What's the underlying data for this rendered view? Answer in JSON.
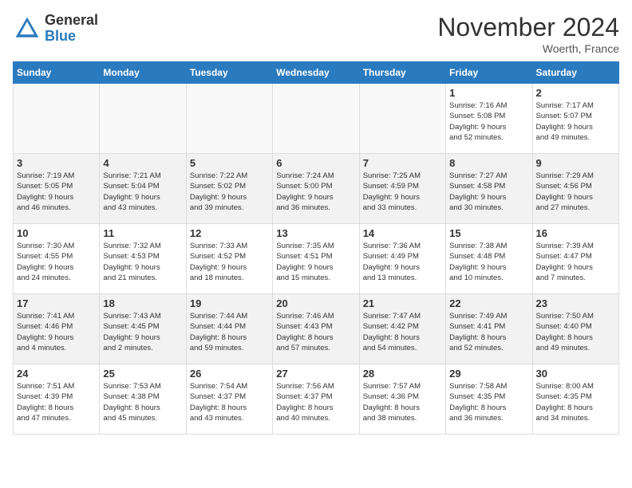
{
  "logo": {
    "general": "General",
    "blue": "Blue"
  },
  "title": "November 2024",
  "location": "Woerth, France",
  "days_of_week": [
    "Sunday",
    "Monday",
    "Tuesday",
    "Wednesday",
    "Thursday",
    "Friday",
    "Saturday"
  ],
  "weeks": [
    [
      {
        "day": "",
        "info": ""
      },
      {
        "day": "",
        "info": ""
      },
      {
        "day": "",
        "info": ""
      },
      {
        "day": "",
        "info": ""
      },
      {
        "day": "",
        "info": ""
      },
      {
        "day": "1",
        "info": "Sunrise: 7:16 AM\nSunset: 5:08 PM\nDaylight: 9 hours\nand 52 minutes."
      },
      {
        "day": "2",
        "info": "Sunrise: 7:17 AM\nSunset: 5:07 PM\nDaylight: 9 hours\nand 49 minutes."
      }
    ],
    [
      {
        "day": "3",
        "info": "Sunrise: 7:19 AM\nSunset: 5:05 PM\nDaylight: 9 hours\nand 46 minutes."
      },
      {
        "day": "4",
        "info": "Sunrise: 7:21 AM\nSunset: 5:04 PM\nDaylight: 9 hours\nand 43 minutes."
      },
      {
        "day": "5",
        "info": "Sunrise: 7:22 AM\nSunset: 5:02 PM\nDaylight: 9 hours\nand 39 minutes."
      },
      {
        "day": "6",
        "info": "Sunrise: 7:24 AM\nSunset: 5:00 PM\nDaylight: 9 hours\nand 36 minutes."
      },
      {
        "day": "7",
        "info": "Sunrise: 7:25 AM\nSunset: 4:59 PM\nDaylight: 9 hours\nand 33 minutes."
      },
      {
        "day": "8",
        "info": "Sunrise: 7:27 AM\nSunset: 4:58 PM\nDaylight: 9 hours\nand 30 minutes."
      },
      {
        "day": "9",
        "info": "Sunrise: 7:29 AM\nSunset: 4:56 PM\nDaylight: 9 hours\nand 27 minutes."
      }
    ],
    [
      {
        "day": "10",
        "info": "Sunrise: 7:30 AM\nSunset: 4:55 PM\nDaylight: 9 hours\nand 24 minutes."
      },
      {
        "day": "11",
        "info": "Sunrise: 7:32 AM\nSunset: 4:53 PM\nDaylight: 9 hours\nand 21 minutes."
      },
      {
        "day": "12",
        "info": "Sunrise: 7:33 AM\nSunset: 4:52 PM\nDaylight: 9 hours\nand 18 minutes."
      },
      {
        "day": "13",
        "info": "Sunrise: 7:35 AM\nSunset: 4:51 PM\nDaylight: 9 hours\nand 15 minutes."
      },
      {
        "day": "14",
        "info": "Sunrise: 7:36 AM\nSunset: 4:49 PM\nDaylight: 9 hours\nand 13 minutes."
      },
      {
        "day": "15",
        "info": "Sunrise: 7:38 AM\nSunset: 4:48 PM\nDaylight: 9 hours\nand 10 minutes."
      },
      {
        "day": "16",
        "info": "Sunrise: 7:39 AM\nSunset: 4:47 PM\nDaylight: 9 hours\nand 7 minutes."
      }
    ],
    [
      {
        "day": "17",
        "info": "Sunrise: 7:41 AM\nSunset: 4:46 PM\nDaylight: 9 hours\nand 4 minutes."
      },
      {
        "day": "18",
        "info": "Sunrise: 7:43 AM\nSunset: 4:45 PM\nDaylight: 9 hours\nand 2 minutes."
      },
      {
        "day": "19",
        "info": "Sunrise: 7:44 AM\nSunset: 4:44 PM\nDaylight: 8 hours\nand 59 minutes."
      },
      {
        "day": "20",
        "info": "Sunrise: 7:46 AM\nSunset: 4:43 PM\nDaylight: 8 hours\nand 57 minutes."
      },
      {
        "day": "21",
        "info": "Sunrise: 7:47 AM\nSunset: 4:42 PM\nDaylight: 8 hours\nand 54 minutes."
      },
      {
        "day": "22",
        "info": "Sunrise: 7:49 AM\nSunset: 4:41 PM\nDaylight: 8 hours\nand 52 minutes."
      },
      {
        "day": "23",
        "info": "Sunrise: 7:50 AM\nSunset: 4:40 PM\nDaylight: 8 hours\nand 49 minutes."
      }
    ],
    [
      {
        "day": "24",
        "info": "Sunrise: 7:51 AM\nSunset: 4:39 PM\nDaylight: 8 hours\nand 47 minutes."
      },
      {
        "day": "25",
        "info": "Sunrise: 7:53 AM\nSunset: 4:38 PM\nDaylight: 8 hours\nand 45 minutes."
      },
      {
        "day": "26",
        "info": "Sunrise: 7:54 AM\nSunset: 4:37 PM\nDaylight: 8 hours\nand 43 minutes."
      },
      {
        "day": "27",
        "info": "Sunrise: 7:56 AM\nSunset: 4:37 PM\nDaylight: 8 hours\nand 40 minutes."
      },
      {
        "day": "28",
        "info": "Sunrise: 7:57 AM\nSunset: 4:36 PM\nDaylight: 8 hours\nand 38 minutes."
      },
      {
        "day": "29",
        "info": "Sunrise: 7:58 AM\nSunset: 4:35 PM\nDaylight: 8 hours\nand 36 minutes."
      },
      {
        "day": "30",
        "info": "Sunrise: 8:00 AM\nSunset: 4:35 PM\nDaylight: 8 hours\nand 34 minutes."
      }
    ]
  ]
}
